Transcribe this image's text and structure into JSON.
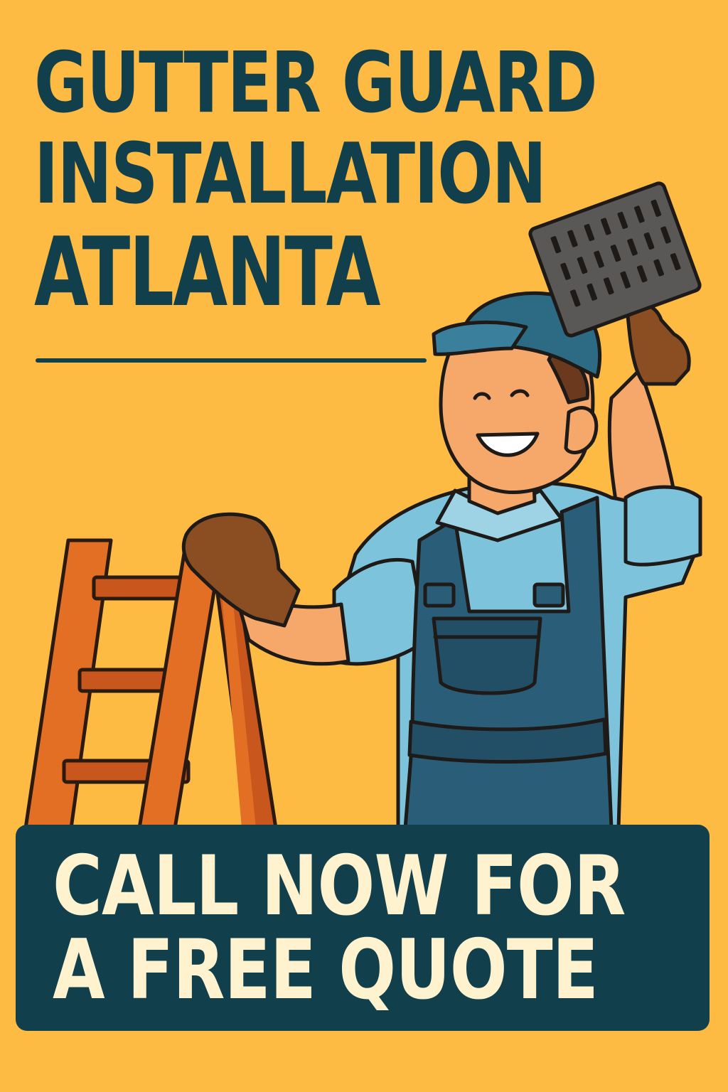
{
  "headline": {
    "line1": "GUTTER GUARD",
    "line2": "INSTALLATION",
    "line3": "ATLANTA"
  },
  "cta": {
    "line1": "CALL NOW FOR",
    "line2": "A FREE QUOTE"
  },
  "colors": {
    "background": "#FDBB43",
    "navy": "#113F4C",
    "cta_text": "#FFF3CF",
    "ladder": "#E36F25",
    "shirt": "#7EC3DC",
    "overalls": "#2A5D78",
    "cap": "#2D6B85",
    "glove": "#8A4E22",
    "skin": "#F6A86A",
    "gutter_guard": "#5A5757"
  },
  "illustration": {
    "icons": [
      "worker-icon",
      "ladder-icon",
      "gutter-guard-icon"
    ]
  }
}
